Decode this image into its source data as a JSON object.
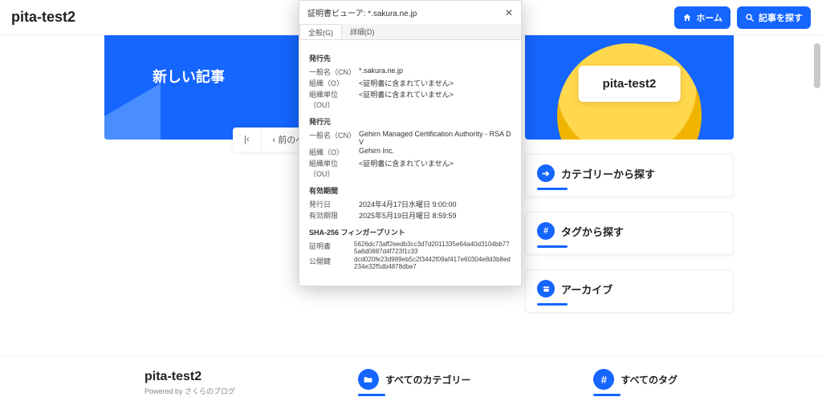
{
  "site": {
    "title": "pita-test2"
  },
  "topButtons": {
    "home": "ホーム",
    "search": "記事を探す"
  },
  "hero": {
    "title": "新しい記事",
    "pagerFirst": "|‹",
    "pagerPrev": "‹  前のペ"
  },
  "logoCard": "pita-test2",
  "widgets": {
    "category": "カテゴリーから探す",
    "tag": "タグから探す",
    "archive": "アーカイブ"
  },
  "footer": {
    "title": "pita-test2",
    "powered": "Powered by さくらのブログ",
    "allCategories": "すべてのカテゴリー",
    "allTags": "すべてのタグ"
  },
  "dialog": {
    "title": "証明書ビューア: *.sakura.ne.jp",
    "tabGeneral": "全般(G)",
    "tabDetail": "詳細(D)",
    "sections": {
      "issuedTo": {
        "title": "発行先",
        "cnLabel": "一般名（CN）",
        "cnValue": "*.sakura.ne.jp",
        "oLabel": "組織（O）",
        "oValue": "<証明書に含まれていません>",
        "ouLabel": "組織単位（OU）",
        "ouValue": "<証明書に含まれていません>"
      },
      "issuedBy": {
        "title": "発行元",
        "cnLabel": "一般名（CN）",
        "cnValue": "Gehirn Managed Certification Authority - RSA DV",
        "oLabel": "組織（O）",
        "oValue": "Gehirn Inc.",
        "ouLabel": "組織単位（OU）",
        "ouValue": "<証明書に含まれていません>"
      },
      "validity": {
        "title": "有効期間",
        "fromLabel": "発行日",
        "fromValue": "2024年4月17日水曜日 9:00:00",
        "toLabel": "有効期限",
        "toValue": "2025年5月19日月曜日 8:59:59"
      },
      "fingerprint": {
        "title": "SHA-256 フィンガープリント",
        "certLabel": "証明書",
        "certValue": "5626dc73aff2eedb3cc3d7d2011335e64a40d3104bb775a6d0887d4f723f1c33",
        "keyLabel": "公開鍵",
        "keyValue": "dcd020fe23d989eb5c2f3442f09af417e60304e8d3b8ed234e32f5db4878dbe7"
      }
    }
  }
}
